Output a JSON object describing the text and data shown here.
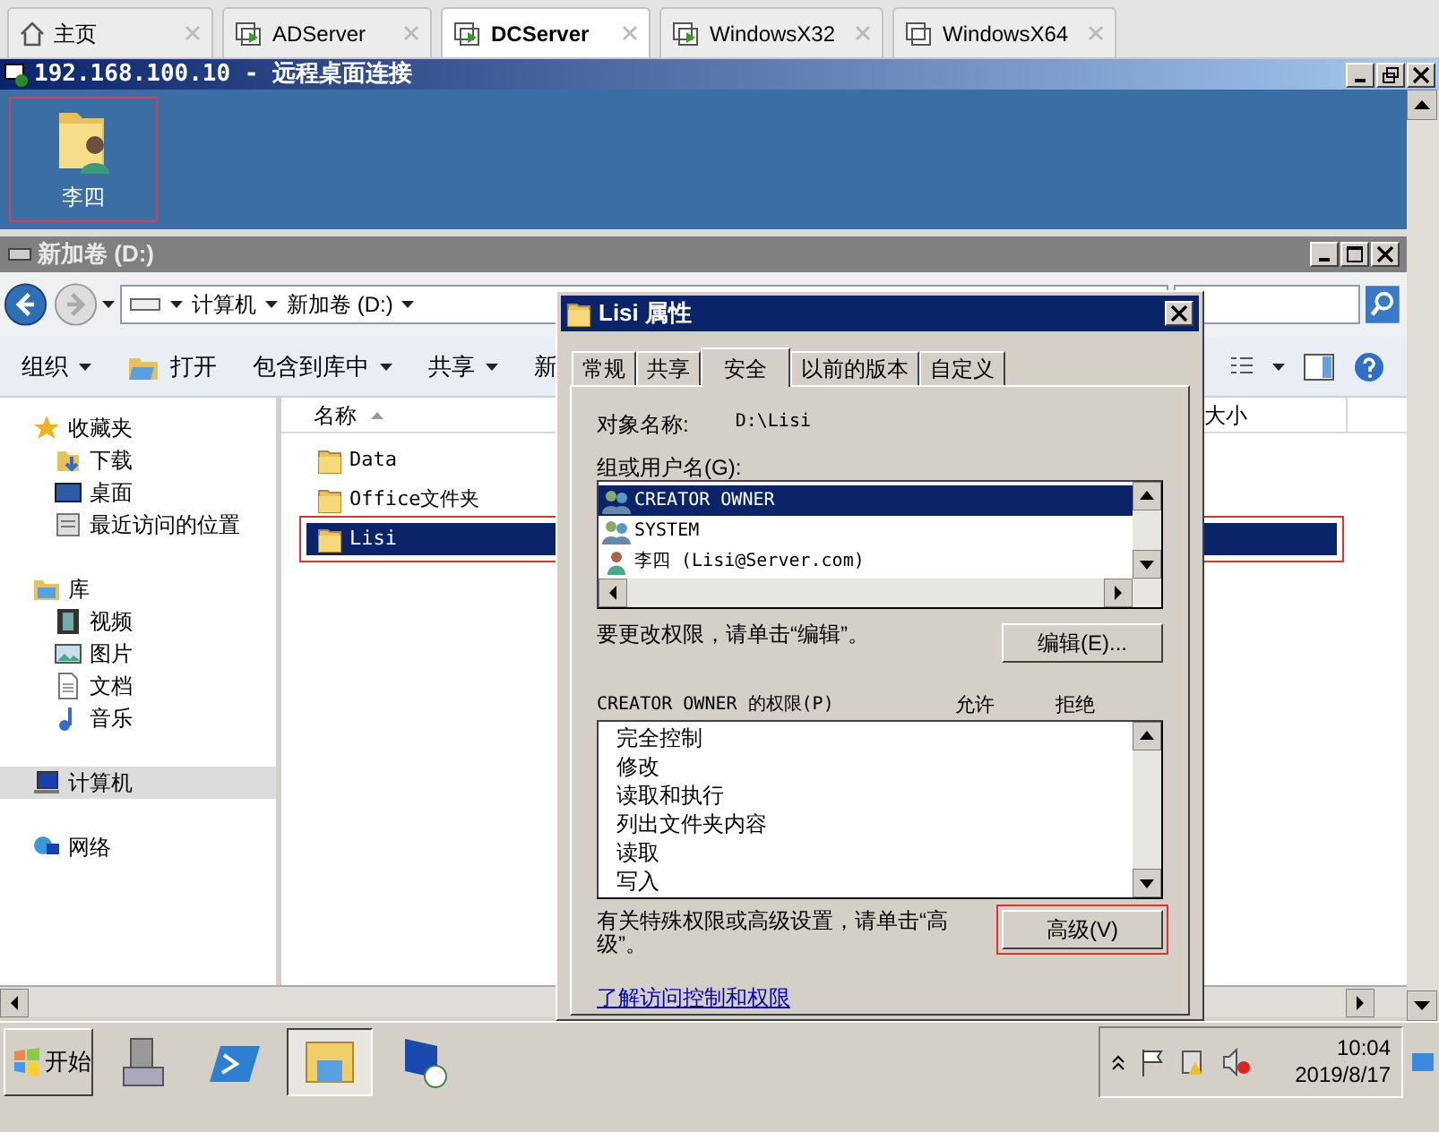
{
  "browser_tabs": [
    {
      "label": "主页",
      "kind": "home",
      "selected": false
    },
    {
      "label": "ADServer",
      "kind": "vm",
      "selected": false
    },
    {
      "label": "DCServer",
      "kind": "vm",
      "selected": true
    },
    {
      "label": "WindowsX32",
      "kind": "vm",
      "selected": false
    },
    {
      "label": "WindowsX64",
      "kind": "vm-off",
      "selected": false
    }
  ],
  "rdp_window": {
    "title": "192.168.100.10 - 远程桌面连接"
  },
  "desktop_icons": [
    {
      "label": "李四",
      "highlighted": true
    }
  ],
  "explorer": {
    "title": "新加卷 (D:)",
    "breadcrumb": [
      "计算机",
      "新加卷 (D:)"
    ],
    "toolbar": [
      {
        "label": "组织",
        "kind": "plain",
        "dropdown": true
      },
      {
        "label": "打开",
        "kind": "open",
        "dropdown": false
      },
      {
        "label": "包含到库中",
        "kind": "plain",
        "dropdown": true
      },
      {
        "label": "共享",
        "kind": "plain",
        "dropdown": true
      },
      {
        "label": "新",
        "kind": "plain",
        "dropdown": false
      }
    ],
    "nav": [
      {
        "label": "收藏夹",
        "kind": "star",
        "selected": false,
        "children": [
          {
            "label": "下载",
            "kind": "download",
            "selected": false
          },
          {
            "label": "桌面",
            "kind": "desktop",
            "selected": false
          },
          {
            "label": "最近访问的位置",
            "kind": "recent",
            "selected": false
          }
        ]
      },
      {
        "label": "库",
        "kind": "library",
        "selected": false,
        "children": [
          {
            "label": "视频",
            "kind": "video",
            "selected": false
          },
          {
            "label": "图片",
            "kind": "picture",
            "selected": false
          },
          {
            "label": "文档",
            "kind": "document",
            "selected": false
          },
          {
            "label": "音乐",
            "kind": "music",
            "selected": false
          }
        ]
      },
      {
        "label": "计算机",
        "kind": "computer",
        "selected": true
      },
      {
        "label": "网络",
        "kind": "network",
        "selected": false
      }
    ],
    "columns": [
      "名称",
      "大小"
    ],
    "files": [
      {
        "name": "Data",
        "selected": false,
        "highlighted": false
      },
      {
        "name": "Office文件夹",
        "selected": false,
        "highlighted": false
      },
      {
        "name": "Lisi",
        "selected": true,
        "highlighted": true
      }
    ]
  },
  "dialog": {
    "title": "Lisi 属性",
    "tabs": [
      {
        "label": "常规",
        "selected": false
      },
      {
        "label": "共享",
        "selected": false
      },
      {
        "label": "安全",
        "selected": true
      },
      {
        "label": "以前的版本",
        "selected": false
      },
      {
        "label": "自定义",
        "selected": false
      }
    ],
    "object_label": "对象名称:",
    "object_value": "D:\\Lisi",
    "users_label": "组或用户名(G):",
    "users": [
      {
        "name": "CREATOR OWNER",
        "kind": "group",
        "selected": true
      },
      {
        "name": "SYSTEM",
        "kind": "group",
        "selected": false
      },
      {
        "name": "李四 (Lisi@Server.com)",
        "kind": "user",
        "selected": false
      }
    ],
    "edit_hint": "要更改权限，请单击“编辑”。",
    "edit_button": {
      "label": "编辑(E)..."
    },
    "permissions_label": "CREATOR OWNER 的权限(P)",
    "allow_label": "允许",
    "deny_label": "拒绝",
    "permissions": [
      "完全控制",
      "修改",
      "读取和执行",
      "列出文件夹内容",
      "读取",
      "写入"
    ],
    "advanced_hint": "有关特殊权限或高级设置，请单击“高级”。",
    "advanced_button": {
      "label": "高级(V)",
      "highlighted": true
    },
    "link": "了解访问控制和权限"
  },
  "taskbar": {
    "start": "开始",
    "apps": [
      {
        "kind": "server-manager",
        "selected": false
      },
      {
        "kind": "powershell",
        "selected": false
      },
      {
        "kind": "explorer",
        "selected": true
      },
      {
        "kind": "remote-desktop",
        "selected": false
      }
    ],
    "time": "10:04",
    "date": "2019/8/17"
  }
}
